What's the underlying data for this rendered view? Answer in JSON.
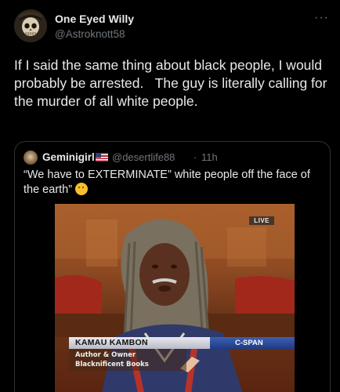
{
  "author": {
    "display_name": "One Eyed Willy",
    "handle": "@Astroknott58"
  },
  "more_icon": "more-horizontal-icon",
  "post_text": "If I said the same thing about black people, I would probably be arrested.   The guy is literally calling for the murder of all white people.",
  "quoted": {
    "display_name": "Geminigirl",
    "flag_icon": "us-flag-icon",
    "handle": "@desertlife88",
    "separator": "·",
    "time": "11h",
    "text": "“We have to EXTERMINATE” white people off the face of the earth”",
    "emoji_icon": "thinking-face-emoji",
    "video": {
      "live_badge": "LIVE",
      "chyron_name": "KAMAU KAMBON",
      "network": "C-SPAN",
      "subtitle_line1": "Author & Owner",
      "subtitle_line2": "Blacknificent Books"
    }
  },
  "colors": {
    "background": "#000000",
    "text_primary": "#e7e9ea",
    "text_secondary": "#71767b",
    "border": "#2f3336"
  }
}
